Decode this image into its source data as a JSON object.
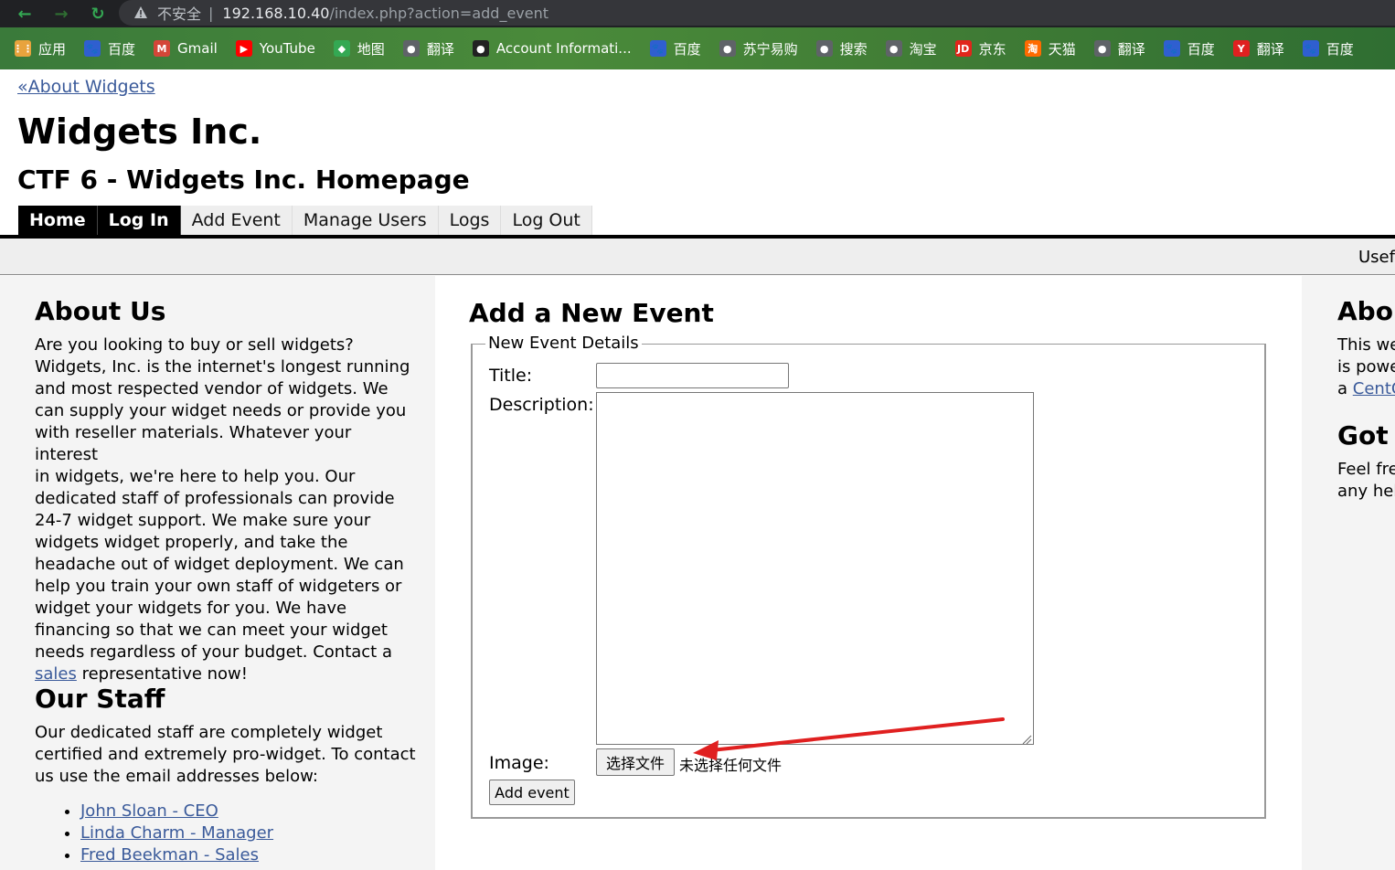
{
  "browser": {
    "insecure_label": "不安全",
    "url_host": "192.168.10.40",
    "url_path": "/index.php?action=add_event",
    "bookmarks": [
      {
        "label": "应用",
        "icon": "apps-grid-icon",
        "color": "#e8a33d"
      },
      {
        "label": "百度",
        "icon": "baidu-icon",
        "color": "#2f5fd0"
      },
      {
        "label": "Gmail",
        "icon": "gmail-icon",
        "color": "#d44638"
      },
      {
        "label": "YouTube",
        "icon": "youtube-icon",
        "color": "#ff0000"
      },
      {
        "label": "地图",
        "icon": "maps-icon",
        "color": "#34a853"
      },
      {
        "label": "翻译",
        "icon": "globe-icon",
        "color": "#5f6368"
      },
      {
        "label": "Account Informati...",
        "icon": "account-icon",
        "color": "#222222"
      },
      {
        "label": "百度",
        "icon": "baidu-icon",
        "color": "#2f5fd0"
      },
      {
        "label": "苏宁易购",
        "icon": "globe-icon",
        "color": "#5f6368"
      },
      {
        "label": "搜索",
        "icon": "globe-icon",
        "color": "#5f6368"
      },
      {
        "label": "淘宝",
        "icon": "globe-icon",
        "color": "#5f6368"
      },
      {
        "label": "京东",
        "icon": "jd-icon",
        "color": "#e1251b"
      },
      {
        "label": "天猫",
        "icon": "tmall-icon",
        "color": "#ff6a00"
      },
      {
        "label": "翻译",
        "icon": "globe-icon",
        "color": "#5f6368"
      },
      {
        "label": "百度",
        "icon": "baidu-icon",
        "color": "#2f5fd0"
      },
      {
        "label": "翻译",
        "icon": "youdao-icon",
        "color": "#e02020"
      },
      {
        "label": "百度",
        "icon": "baidu-icon",
        "color": "#2f5fd0"
      }
    ]
  },
  "header": {
    "back_link": "«About Widgets",
    "site_title": "Widgets Inc.",
    "site_subtitle": "CTF 6 - Widgets Inc. Homepage"
  },
  "nav": {
    "tabs": [
      "Home",
      "Log In",
      "Add Event",
      "Manage Users",
      "Logs",
      "Log Out"
    ]
  },
  "useful_bar": {
    "text": "Usefu"
  },
  "left": {
    "about_heading": "About Us",
    "about_lines": [
      "Are you looking to buy or sell widgets?",
      "Widgets, Inc. is the internet's longest running",
      "and most respected vendor of widgets. We",
      "can supply your widget needs or provide you",
      "with reseller materials. Whatever your interest",
      "in widgets, we're here to help you. Our",
      "dedicated staff of professionals can provide",
      "24-7 widget support. We make sure your",
      "widgets widget properly, and take the",
      "headache out of widget deployment. We can",
      "help you train your own staff of widgeters or",
      "widget your widgets for you. We have",
      "financing so that we can meet your widget",
      "needs regardless of your budget. Contact a"
    ],
    "sales_link": "sales",
    "sales_tail": " representative now!",
    "staff_heading": "Our Staff",
    "staff_lines": [
      "Our dedicated staff are completely widget",
      "certified and extremely pro-widget. To contact",
      "us use the email addresses below:"
    ],
    "staff": [
      "John Sloan - CEO",
      "Linda Charm - Manager",
      "Fred Beekman - Sales"
    ]
  },
  "main": {
    "heading": "Add a New Event",
    "legend": "New Event Details",
    "title_label": "Title:",
    "title_value": "",
    "description_label": "Description:",
    "description_value": "",
    "image_label": "Image:",
    "file_button": "选择文件",
    "file_status": "未选择任何文件",
    "submit": "Add event"
  },
  "right": {
    "about_heading": "Abou",
    "about_lines": [
      "This we",
      "is powe"
    ],
    "about_prefix": "a ",
    "about_link": "CentC",
    "got_heading": "Got C",
    "got_lines": [
      "Feel fre",
      "any hel"
    ]
  },
  "annotation": {
    "arrow_color": "#e02020"
  }
}
